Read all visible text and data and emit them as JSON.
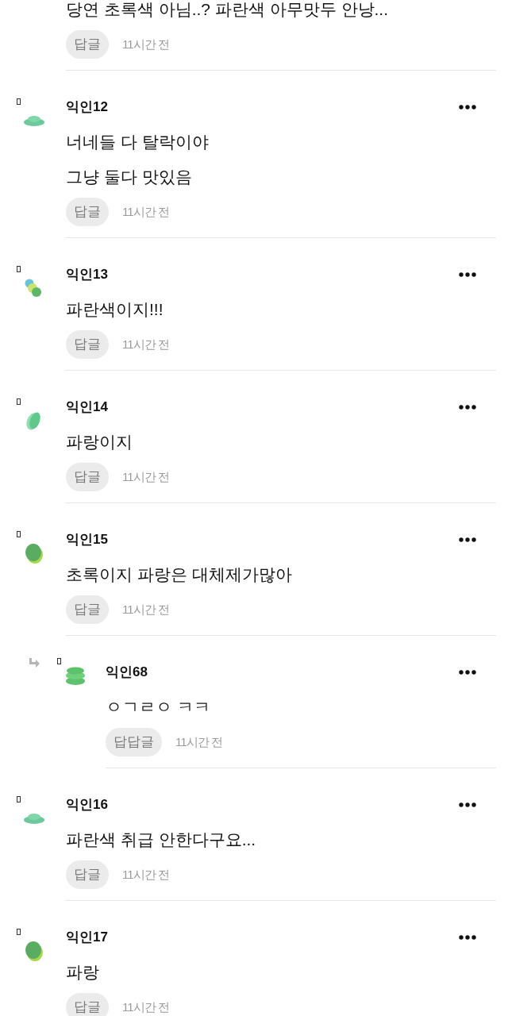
{
  "top_fragment": {
    "lines": [
      "당연 초록색 아님..? 파란색 아무맛두 안낭..."
    ],
    "reply_label": "답글",
    "time": "11시간 전"
  },
  "comments": [
    {
      "kind": "comment",
      "avatar": {
        "kind": "disc"
      },
      "name": "익인12",
      "lines": [
        "너네들 다 탈락이야",
        "그냥 둘다 맛있음"
      ],
      "reply_label": "답글",
      "time": "11시간 전"
    },
    {
      "kind": "comment",
      "avatar": {
        "kind": "dots"
      },
      "name": "익인13",
      "lines": [
        "파란색이지!!!"
      ],
      "reply_label": "답글",
      "time": "11시간 전"
    },
    {
      "kind": "comment",
      "avatar": {
        "kind": "leaf"
      },
      "name": "익인14",
      "lines": [
        "파랑이지"
      ],
      "reply_label": "답글",
      "time": "11시간 전"
    },
    {
      "kind": "comment",
      "avatar": {
        "kind": "egg"
      },
      "name": "익인15",
      "lines": [
        "초록이지 파랑은 대체제가많아"
      ],
      "reply_label": "답글",
      "time": "11시간 전"
    },
    {
      "kind": "reply",
      "avatar": {
        "kind": "stack"
      },
      "name": "익인68",
      "lines": [
        "ㅇㄱㄹㅇ ㅋㅋ"
      ],
      "reply_label": "답답글",
      "time": "11시간 전"
    },
    {
      "kind": "comment",
      "avatar": {
        "kind": "disc"
      },
      "name": "익인16",
      "lines": [
        "파란색 취급 안한다구요..."
      ],
      "reply_label": "답글",
      "time": "11시간 전"
    },
    {
      "kind": "comment",
      "avatar": {
        "kind": "egg"
      },
      "name": "익인17",
      "lines": [
        "파랑"
      ],
      "reply_label": "답글",
      "time": "11시간 전"
    }
  ]
}
